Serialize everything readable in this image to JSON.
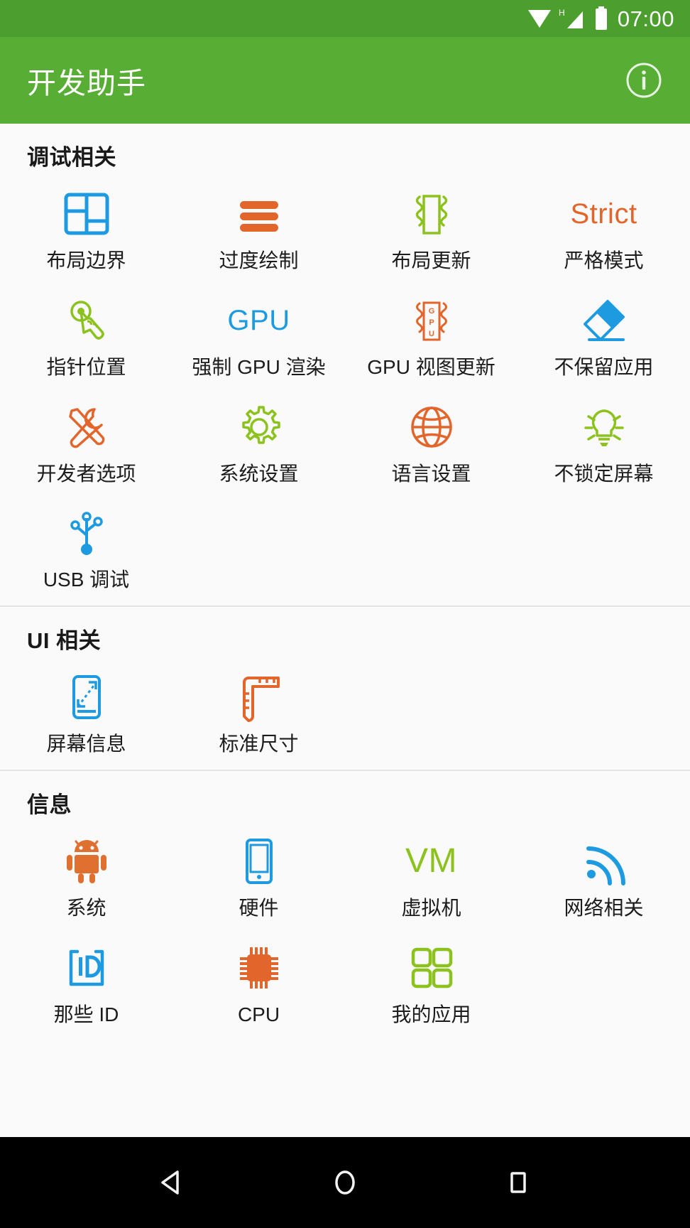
{
  "statusbar": {
    "time": "07:00",
    "icons": [
      "wifi-icon",
      "signal-h-icon",
      "battery-icon"
    ]
  },
  "appbar": {
    "title": "开发助手",
    "action_icon": "info-icon",
    "background": "#58ae35"
  },
  "colors": {
    "blue": "#1e9be0",
    "orange": "#e2662c",
    "green": "#8cc21e",
    "android_orange": "#e0702f",
    "text": "#1c1c1c",
    "divider": "#e4e4e4",
    "background": "#fafafa",
    "statusbar": "#4c9f2f",
    "navbar": "#000000"
  },
  "sections": [
    {
      "title": "调试相关",
      "items": [
        {
          "label": "布局边界",
          "icon": "layout-bounds-icon",
          "color": "#1e9be0"
        },
        {
          "label": "过度绘制",
          "icon": "overdraw-bars-icon",
          "color": "#e2662c"
        },
        {
          "label": "布局更新",
          "icon": "layout-update-icon",
          "color": "#8cc21e"
        },
        {
          "label": "严格模式",
          "icon": "strict-text-icon",
          "color": "#e2662c",
          "text": "Strict"
        },
        {
          "label": "指针位置",
          "icon": "pointer-tap-icon",
          "color": "#8cc21e"
        },
        {
          "label": "强制 GPU 渲染",
          "icon": "gpu-text-icon",
          "color": "#1e9be0",
          "text": "GPU"
        },
        {
          "label": "GPU 视图更新",
          "icon": "gpu-view-update-icon",
          "color": "#e2662c"
        },
        {
          "label": "不保留应用",
          "icon": "eraser-icon",
          "color": "#1e9be0"
        },
        {
          "label": "开发者选项",
          "icon": "tools-icon",
          "color": "#e2662c"
        },
        {
          "label": "系统设置",
          "icon": "gear-icon",
          "color": "#8cc21e"
        },
        {
          "label": "语言设置",
          "icon": "globe-icon",
          "color": "#e2662c"
        },
        {
          "label": "不锁定屏幕",
          "icon": "lightbulb-icon",
          "color": "#8cc21e"
        },
        {
          "label": "USB 调试",
          "icon": "usb-icon",
          "color": "#1e9be0"
        }
      ]
    },
    {
      "title": "UI 相关",
      "items": [
        {
          "label": "屏幕信息",
          "icon": "screen-info-icon",
          "color": "#1e9be0"
        },
        {
          "label": "标准尺寸",
          "icon": "ruler-icon",
          "color": "#e2662c"
        }
      ]
    },
    {
      "title": "信息",
      "items": [
        {
          "label": "系统",
          "icon": "android-robot-icon",
          "color": "#e0702f"
        },
        {
          "label": "硬件",
          "icon": "phone-icon",
          "color": "#1e9be0"
        },
        {
          "label": "虚拟机",
          "icon": "vm-text-icon",
          "color": "#8cc21e",
          "text": "VM"
        },
        {
          "label": "网络相关",
          "icon": "network-signal-icon",
          "color": "#1e9be0"
        },
        {
          "label": "那些 ID",
          "icon": "id-bracket-icon",
          "color": "#1e9be0"
        },
        {
          "label": "CPU",
          "icon": "cpu-chip-icon",
          "color": "#e2662c"
        },
        {
          "label": "我的应用",
          "icon": "apps-grid-icon",
          "color": "#8cc21e"
        }
      ]
    }
  ],
  "navbar": {
    "buttons": [
      {
        "name": "back-button",
        "icon": "triangle-back-icon"
      },
      {
        "name": "home-button",
        "icon": "circle-home-icon"
      },
      {
        "name": "recents-button",
        "icon": "square-recents-icon"
      }
    ]
  }
}
